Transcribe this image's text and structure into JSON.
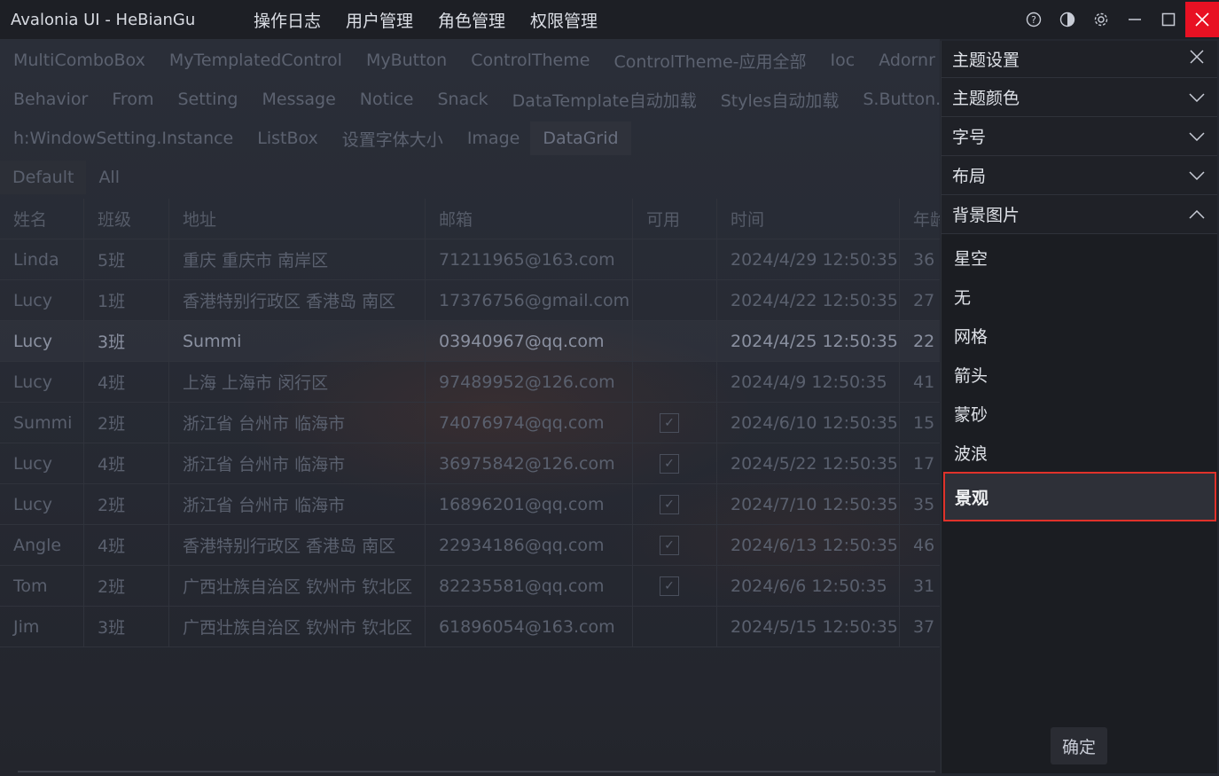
{
  "app": {
    "title": "Avalonia UI - HeBianGu",
    "menu": [
      "操作日志",
      "用户管理",
      "角色管理",
      "权限管理"
    ]
  },
  "tabs": {
    "row1": [
      "MultiComboBox",
      "MyTemplatedControl",
      "MyButton",
      "ControlTheme",
      "ControlTheme-应用全部",
      "Ioc",
      "Adornr"
    ],
    "row2": [
      "Behavior",
      "From",
      "Setting",
      "Message",
      "Notice",
      "Snack",
      "DataTemplate自动加载",
      "Styles自动加载",
      "S.Button.Geo"
    ],
    "row3": [
      "h:WindowSetting.Instance",
      "ListBox",
      "设置字体大小",
      "Image",
      "DataGrid"
    ]
  },
  "subtabs": [
    "Default",
    "All"
  ],
  "grid": {
    "headers": [
      "姓名",
      "班级",
      "地址",
      "邮箱",
      "可用",
      "时间",
      "年龄"
    ],
    "rows": [
      {
        "name": "Linda",
        "cls": "5班",
        "addr": "重庆 重庆市 南岸区",
        "email": "71211965@163.com",
        "enabled": false,
        "time": "2024/4/29 12:50:35",
        "age": "36"
      },
      {
        "name": "Lucy",
        "cls": "1班",
        "addr": "香港特别行政区 香港岛 南区",
        "email": "17376756@gmail.com",
        "enabled": false,
        "time": "2024/4/22 12:50:35",
        "age": "27"
      },
      {
        "name": "Lucy",
        "cls": "3班",
        "addr": "Summi",
        "email": "03940967@qq.com",
        "enabled": false,
        "time": "2024/4/25 12:50:35",
        "age": "22"
      },
      {
        "name": "Lucy",
        "cls": "4班",
        "addr": "上海 上海市 闵行区",
        "email": "97489952@126.com",
        "enabled": false,
        "time": "2024/4/9 12:50:35",
        "age": "41"
      },
      {
        "name": "Summi",
        "cls": "2班",
        "addr": "浙江省 台州市 临海市",
        "email": "74076974@qq.com",
        "enabled": true,
        "time": "2024/6/10 12:50:35",
        "age": "15"
      },
      {
        "name": "Lucy",
        "cls": "4班",
        "addr": "浙江省 台州市 临海市",
        "email": "36975842@126.com",
        "enabled": true,
        "time": "2024/5/22 12:50:35",
        "age": "17"
      },
      {
        "name": "Lucy",
        "cls": "2班",
        "addr": "浙江省 台州市 临海市",
        "email": "16896201@qq.com",
        "enabled": true,
        "time": "2024/7/10 12:50:35",
        "age": "35"
      },
      {
        "name": "Angle",
        "cls": "4班",
        "addr": "香港特别行政区 香港岛 南区",
        "email": "22934186@qq.com",
        "enabled": true,
        "time": "2024/6/13 12:50:35",
        "age": "46"
      },
      {
        "name": "Tom",
        "cls": "2班",
        "addr": "广西壮族自治区 钦州市 钦北区",
        "email": "82235581@qq.com",
        "enabled": true,
        "time": "2024/6/6 12:50:35",
        "age": "31"
      },
      {
        "name": "Jim",
        "cls": "3班",
        "addr": "广西壮族自治区 钦州市 钦北区",
        "email": "61896054@163.com",
        "enabled": false,
        "time": "2024/5/15 12:50:35",
        "age": "37"
      }
    ]
  },
  "panel": {
    "title": "主题设置",
    "sections": [
      "主题颜色",
      "字号",
      "布局",
      "背景图片"
    ],
    "bg_options": [
      "星空",
      "无",
      "网格",
      "箭头",
      "蒙砂",
      "波浪",
      "景观"
    ],
    "selected_option": "景观",
    "confirm_label": "确定"
  },
  "colors": {
    "close_button": "#e81123",
    "highlight_border": "#e0322a"
  }
}
